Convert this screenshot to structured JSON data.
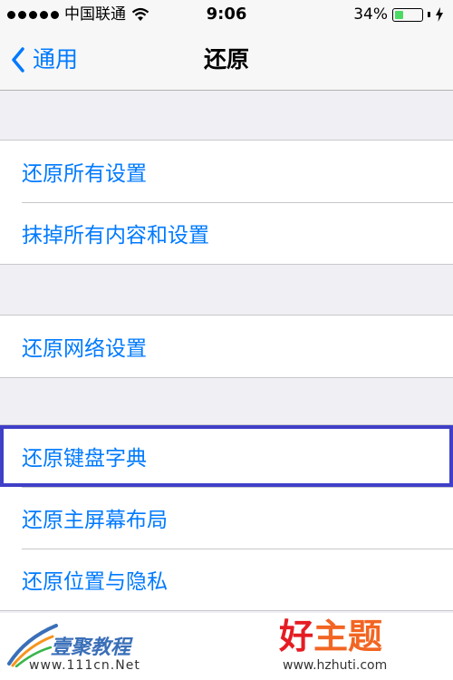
{
  "status_bar": {
    "carrier": "中国联通",
    "time": "9:06",
    "battery_percent": "34%",
    "battery_level": 0.34,
    "signal_dots": 5
  },
  "nav": {
    "back_label": "通用",
    "title": "还原"
  },
  "groups": [
    {
      "items": [
        "还原所有设置",
        "抹掉所有内容和设置"
      ]
    },
    {
      "items": [
        "还原网络设置"
      ]
    },
    {
      "items": [
        "还原键盘字典",
        "还原主屏幕布局",
        "还原位置与隐私"
      ]
    }
  ],
  "colors": {
    "accent": "#007aff",
    "highlight_border": "#3f3fc8",
    "battery": "#4cd964"
  },
  "watermark": {
    "left_brand": "壹聚教程",
    "left_url": "www.111cn.Net",
    "right_title_1": "好",
    "right_title_2": "主题",
    "right_url": "www.hzhuti.com"
  }
}
